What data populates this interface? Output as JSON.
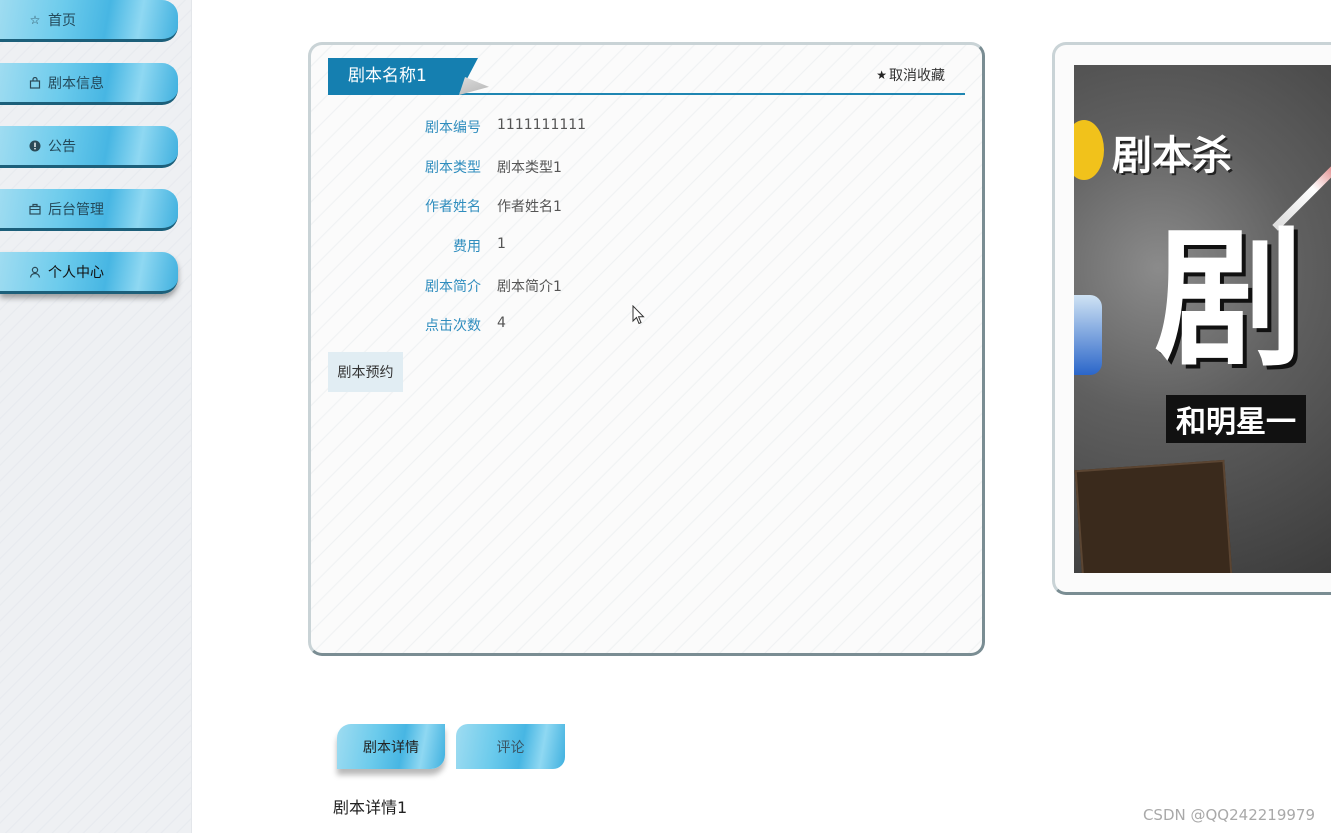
{
  "sidebar": {
    "items": [
      {
        "label": "首页",
        "icon": "star-outline-icon"
      },
      {
        "label": "剧本信息",
        "icon": "bag-icon"
      },
      {
        "label": "公告",
        "icon": "alert-icon"
      },
      {
        "label": "后台管理",
        "icon": "building-icon"
      },
      {
        "label": "个人中心",
        "icon": "user-icon"
      }
    ]
  },
  "detail": {
    "title": "剧本名称1",
    "favorite_label": "取消收藏",
    "fields": [
      {
        "label": "剧本编号",
        "value": "1111111111"
      },
      {
        "label": "剧本类型",
        "value": "剧本类型1"
      },
      {
        "label": "作者姓名",
        "value": "作者姓名1"
      },
      {
        "label": "费用",
        "value": "1"
      },
      {
        "label": "剧本简介",
        "value": "剧本简介1"
      },
      {
        "label": "点击次数",
        "value": "4"
      }
    ],
    "reserve_label": "剧本预约"
  },
  "poster": {
    "logo_text": "剧本杀",
    "big_text": "剧",
    "slogan": "和明星一"
  },
  "tabs": [
    {
      "label": "剧本详情",
      "active": true
    },
    {
      "label": "评论",
      "active": false
    }
  ],
  "content": {
    "detail_text": "剧本详情1"
  },
  "watermark": "CSDN @QQ242219979",
  "colors": {
    "accent": "#157fb0",
    "label": "#2f8dbe",
    "nav_gradient": "#47b6e3"
  }
}
